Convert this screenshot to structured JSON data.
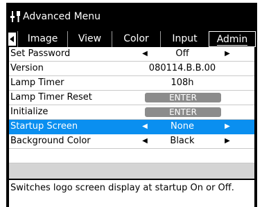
{
  "window": {
    "title": "Advanced Menu",
    "icon": "settings-tools-icon"
  },
  "tabs": [
    {
      "label": "Image",
      "active": false
    },
    {
      "label": "View",
      "active": false
    },
    {
      "label": "Color",
      "active": false
    },
    {
      "label": "Input",
      "active": false
    },
    {
      "label": "Admin",
      "active": true
    }
  ],
  "rows": [
    {
      "label": "Set Password",
      "value": "Off",
      "arrows": true
    },
    {
      "label": "Version",
      "value": "080114.B.B.00",
      "arrows": false
    },
    {
      "label": "Lamp Timer",
      "value": "108h",
      "arrows": false
    },
    {
      "label": "Lamp Timer Reset",
      "button": "ENTER"
    },
    {
      "label": "Initialize",
      "button": "ENTER"
    },
    {
      "label": "Startup Screen",
      "value": "None",
      "arrows": true,
      "selected": true
    },
    {
      "label": "Background Color",
      "value": "Black",
      "arrows": true
    }
  ],
  "help_text": "Switches logo screen display at startup On or Off.",
  "colors": {
    "selection": "#0a8ff0",
    "menu_background": "#000000",
    "button": "#8c8c8c"
  }
}
